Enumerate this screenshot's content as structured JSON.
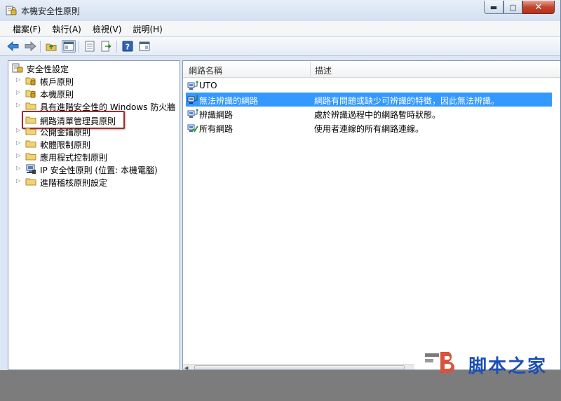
{
  "window": {
    "title": "本機安全性原則",
    "controls": {
      "minimize": "▬",
      "maximize": "▢",
      "close": "✕"
    }
  },
  "menu": [
    "檔案(F)",
    "執行(A)",
    "檢視(V)",
    "說明(H)"
  ],
  "toolbar": [
    "back-icon",
    "forward-icon",
    "up-folder-icon",
    "show-tree-icon",
    "properties-icon",
    "export-icon",
    "help-icon",
    "console-icon"
  ],
  "tree": {
    "root": "安全性設定",
    "items": [
      {
        "label": "帳戶原則",
        "icon": "folder-lock-icon"
      },
      {
        "label": "本機原則",
        "icon": "folder-lock-icon"
      },
      {
        "label": "具有進階安全性的 Windows 防火牆",
        "icon": "folder-icon"
      },
      {
        "label": "網路清單管理員原則",
        "icon": "folder-icon",
        "highlighted": true
      },
      {
        "label": "公開金鑰原則",
        "icon": "folder-icon"
      },
      {
        "label": "軟體限制原則",
        "icon": "folder-icon"
      },
      {
        "label": "應用程式控制原則",
        "icon": "folder-icon"
      },
      {
        "label": "IP 安全性原則 (位置: 本機電腦)",
        "icon": "ip-security-icon"
      },
      {
        "label": "進階稽核原則設定",
        "icon": "folder-icon"
      }
    ]
  },
  "list": {
    "columns": [
      "網路名稱",
      "描述"
    ],
    "rows": [
      {
        "name": "UTO",
        "desc": "",
        "icon": "network-icon"
      },
      {
        "name": "無法辨識的網路",
        "desc": "網路有問題或缺少可辨識的特徵，因此無法辨識。",
        "icon": "network-icon",
        "selected": true
      },
      {
        "name": "辨識網路",
        "desc": "處於辨識過程中的網路暫時狀態。",
        "icon": "network-icon"
      },
      {
        "name": "所有網路",
        "desc": "使用者連線的所有網路連線。",
        "icon": "network-check-icon"
      }
    ]
  },
  "watermark": {
    "text": "脚本之家"
  },
  "colors": {
    "selection": "#3399ff",
    "highlight_border": "#a52a2a",
    "watermark_text": "#1a4fb4",
    "watermark_logo": "#d9533a"
  }
}
